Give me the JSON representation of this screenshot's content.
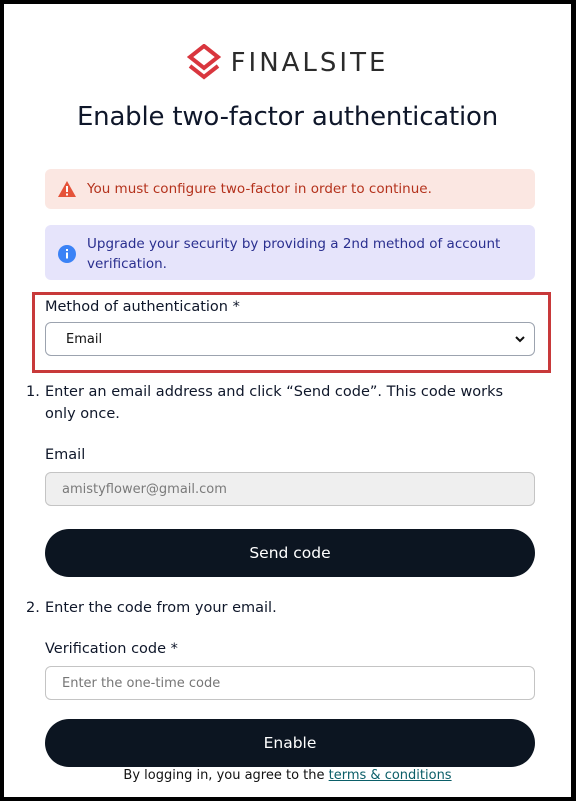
{
  "brand": {
    "name": "FINALSITE",
    "icon": "finalsite-logo-icon",
    "accent": "#d9363e"
  },
  "page": {
    "title": "Enable two-factor authentication"
  },
  "alerts": {
    "error": {
      "icon": "warning-icon",
      "text": "You must configure two-factor in order to continue.",
      "color": "#b4321c",
      "background": "#fbe7e2"
    },
    "info": {
      "icon": "info-icon",
      "text": "Upgrade your security by providing a 2nd method of account verification.",
      "color": "#2a2f8f",
      "background": "#e6e4fb"
    }
  },
  "method": {
    "label": "Method of authentication *",
    "selected": "Email"
  },
  "steps": [
    {
      "number": "1.",
      "text": "Enter an email address and click “Send code”. This code works only once."
    },
    {
      "number": "2.",
      "text": "Enter the code from your email."
    }
  ],
  "email": {
    "label": "Email",
    "value": "amistyflower@gmail.com"
  },
  "send_button": {
    "label": "Send code"
  },
  "verification": {
    "label": "Verification code *",
    "placeholder": "Enter the one-time code"
  },
  "enable_button": {
    "label": "Enable"
  },
  "footer": {
    "prefix": "By logging in, you agree to the ",
    "link": "terms & conditions"
  }
}
